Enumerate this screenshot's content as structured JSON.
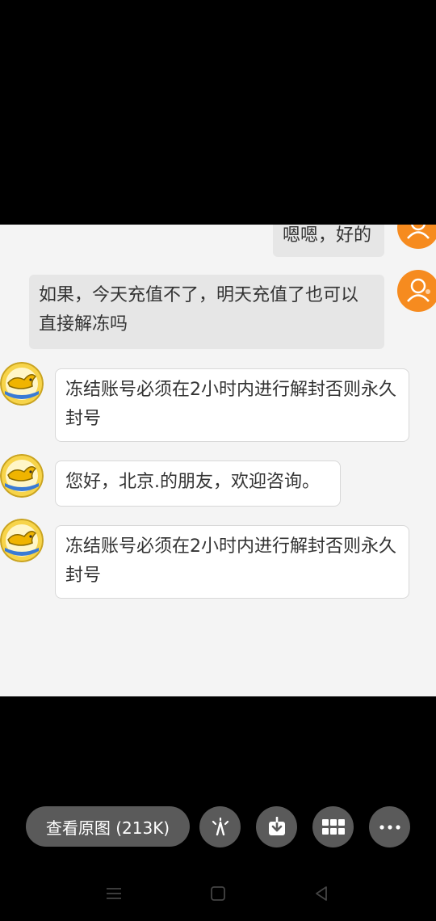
{
  "chat": {
    "messages": [
      {
        "side": "out",
        "text": "嗯嗯，好的"
      },
      {
        "side": "out",
        "text": "如果，今天充值不了，明天充值了也可以直接解冻吗"
      },
      {
        "side": "in",
        "text": "冻结账号必须在2小时内进行解封否则永久封号"
      },
      {
        "side": "in",
        "text": "您好，北京.的朋友，欢迎咨询。"
      },
      {
        "side": "in",
        "text": "冻结账号必须在2小时内进行解封否则永久封号"
      }
    ]
  },
  "toolbar": {
    "view_original_label": "查看原图 (213K)",
    "buttons": [
      "edit-icon",
      "download-icon",
      "grid-icon",
      "more-icon"
    ]
  },
  "navbar": {
    "icons": [
      "menu-icon",
      "home-icon",
      "back-icon"
    ]
  },
  "colors": {
    "user_avatar": "#f68b1f",
    "bubble_out": "#e6e6e6",
    "bubble_in": "#ffffff",
    "toolbar_button": "#5a5a5a"
  }
}
